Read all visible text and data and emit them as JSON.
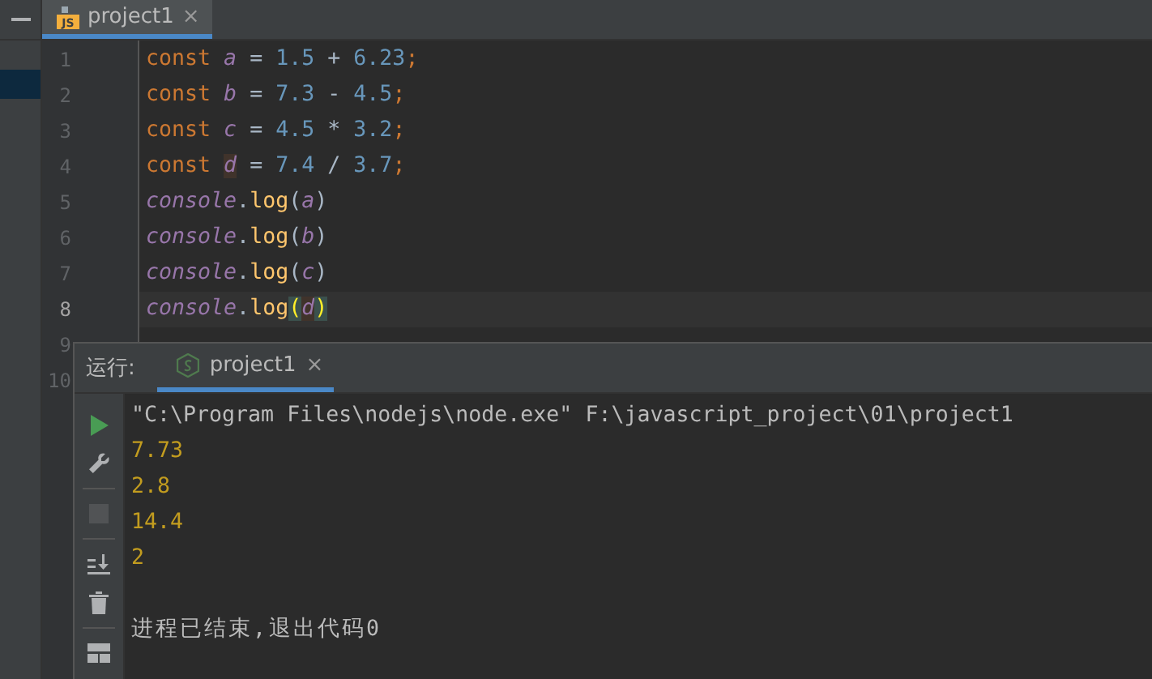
{
  "editor_tab": {
    "icon_label": "JS",
    "title": "project1",
    "close": "×",
    "selected": true
  },
  "project_pane": {
    "rows": [
      {
        "selected": false
      },
      {
        "selected": true
      }
    ]
  },
  "code": [
    {
      "number": "1",
      "current": false,
      "tokens": [
        {
          "text": "const ",
          "kind": "keyword"
        },
        {
          "text": "a",
          "kind": "variable"
        },
        {
          "text": " = ",
          "kind": "operator"
        },
        {
          "text": "1.5",
          "kind": "number"
        },
        {
          "text": " + ",
          "kind": "operator"
        },
        {
          "text": "6.23",
          "kind": "number"
        },
        {
          "text": ";",
          "kind": "keyword"
        }
      ]
    },
    {
      "number": "2",
      "current": false,
      "tokens": [
        {
          "text": "const ",
          "kind": "keyword"
        },
        {
          "text": "b",
          "kind": "variable"
        },
        {
          "text": " = ",
          "kind": "operator"
        },
        {
          "text": "7.3",
          "kind": "number"
        },
        {
          "text": " - ",
          "kind": "operator"
        },
        {
          "text": "4.5",
          "kind": "number"
        },
        {
          "text": ";",
          "kind": "keyword"
        }
      ]
    },
    {
      "number": "3",
      "current": false,
      "tokens": [
        {
          "text": "const ",
          "kind": "keyword"
        },
        {
          "text": "c",
          "kind": "variable"
        },
        {
          "text": " = ",
          "kind": "operator"
        },
        {
          "text": "4.5",
          "kind": "number"
        },
        {
          "text": " * ",
          "kind": "operator"
        },
        {
          "text": "3.2",
          "kind": "number"
        },
        {
          "text": ";",
          "kind": "keyword"
        }
      ]
    },
    {
      "number": "4",
      "current": false,
      "tokens": [
        {
          "text": "const ",
          "kind": "keyword"
        },
        {
          "text": "d",
          "kind": "variable",
          "highlight": true
        },
        {
          "text": " = ",
          "kind": "operator"
        },
        {
          "text": "7.4",
          "kind": "number"
        },
        {
          "text": " / ",
          "kind": "operator"
        },
        {
          "text": "3.7",
          "kind": "number"
        },
        {
          "text": ";",
          "kind": "keyword"
        }
      ]
    },
    {
      "number": "5",
      "current": false,
      "tokens": [
        {
          "text": "console",
          "kind": "object"
        },
        {
          "text": ".",
          "kind": "operator"
        },
        {
          "text": "log",
          "kind": "method"
        },
        {
          "text": "(",
          "kind": "paren"
        },
        {
          "text": "a",
          "kind": "variable"
        },
        {
          "text": ")",
          "kind": "paren"
        }
      ]
    },
    {
      "number": "6",
      "current": false,
      "tokens": [
        {
          "text": "console",
          "kind": "object"
        },
        {
          "text": ".",
          "kind": "operator"
        },
        {
          "text": "log",
          "kind": "method"
        },
        {
          "text": "(",
          "kind": "paren"
        },
        {
          "text": "b",
          "kind": "variable"
        },
        {
          "text": ")",
          "kind": "paren"
        }
      ]
    },
    {
      "number": "7",
      "current": false,
      "tokens": [
        {
          "text": "console",
          "kind": "object"
        },
        {
          "text": ".",
          "kind": "operator"
        },
        {
          "text": "log",
          "kind": "method"
        },
        {
          "text": "(",
          "kind": "paren"
        },
        {
          "text": "c",
          "kind": "variable"
        },
        {
          "text": ")",
          "kind": "paren"
        }
      ]
    },
    {
      "number": "8",
      "current": true,
      "tokens": [
        {
          "text": "console",
          "kind": "object"
        },
        {
          "text": ".",
          "kind": "operator"
        },
        {
          "text": "log",
          "kind": "method"
        },
        {
          "text": "(",
          "kind": "paren",
          "highlight": true
        },
        {
          "text": "d",
          "kind": "variable",
          "highlight": true
        },
        {
          "text": ")",
          "kind": "paren",
          "highlight": true
        }
      ]
    },
    {
      "number": "9",
      "current": false
    },
    {
      "number": "10",
      "current": false
    }
  ],
  "run_panel": {
    "label": "运行:",
    "tab": {
      "title": "project1",
      "close": "×",
      "selected": true
    },
    "toolbar": [
      {
        "kind": "play",
        "disabled": false
      },
      {
        "kind": "wrench",
        "disabled": false
      },
      {
        "kind": "stop",
        "disabled": true
      },
      {
        "kind": "scroll",
        "disabled": false
      },
      {
        "kind": "trash",
        "disabled": false
      },
      {
        "kind": "layout",
        "disabled": false
      }
    ],
    "console": [
      {
        "kind": "command",
        "text": "\"C:\\Program Files\\nodejs\\node.exe\" F:\\javascript_project\\01\\project1"
      },
      {
        "kind": "output",
        "text": "7.73"
      },
      {
        "kind": "output",
        "text": "2.8"
      },
      {
        "kind": "output",
        "text": "14.4"
      },
      {
        "kind": "output",
        "text": "2"
      },
      {
        "kind": "status",
        "text": "进程已结束,退出代码0"
      }
    ]
  }
}
